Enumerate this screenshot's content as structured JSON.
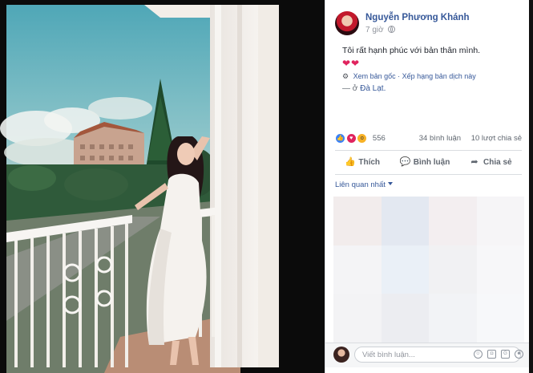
{
  "post": {
    "author": "Nguyễn Phương Khánh",
    "time": "7 giờ",
    "caption": "Tôi rất hạnh phúc với bản thân mình.",
    "hearts": "❤❤",
    "see_original": "Xem bản gốc",
    "rate_translation": "Xếp hạng bản dịch này",
    "location_prefix": "— ở",
    "location": "Đà Lạt."
  },
  "reactions": {
    "count": "556",
    "comments": "34 bình luận",
    "shares": "10 lượt chia sẻ"
  },
  "actions": {
    "like": "Thích",
    "comment": "Bình luận",
    "share": "Chia sẻ"
  },
  "comments": {
    "sort_label": "Liên quan nhất",
    "placeholder": "Viết bình luận..."
  },
  "icons": [
    "globe-icon",
    "like-icon",
    "comment-icon",
    "share-icon",
    "emoji-icon",
    "camera-icon",
    "gif-icon",
    "sticker-icon"
  ],
  "colors": {
    "link": "#365899",
    "like_reaction": "#3b82f6",
    "love_reaction": "#e0245e",
    "wow_reaction": "#f7b125"
  }
}
